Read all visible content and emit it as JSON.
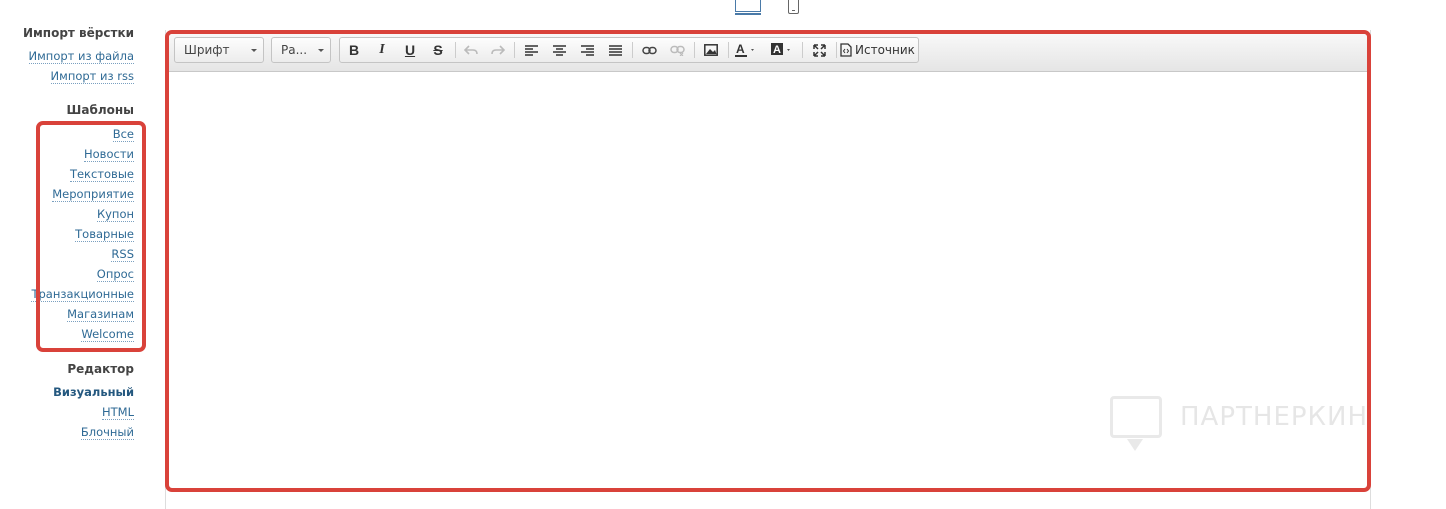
{
  "sidebar": {
    "import": {
      "title": "Импорт вёрстки",
      "items": [
        "Импорт из файла",
        "Импорт из rss"
      ]
    },
    "templates": {
      "title": "Шаблоны",
      "items": [
        "Все",
        "Новости",
        "Текстовые",
        "Мероприятие",
        "Купон",
        "Товарные",
        "RSS",
        "Опрос",
        "Транзакционные",
        "Магазинам",
        "Welcome"
      ]
    },
    "editor": {
      "title": "Редактор",
      "items": [
        "Визуальный",
        "HTML",
        "Блочный"
      ],
      "active": "Визуальный"
    }
  },
  "toolbar": {
    "font_label": "Шрифт",
    "size_label": "Ра...",
    "source_label": "Источник",
    "icons": [
      "bold-icon",
      "italic-icon",
      "underline-icon",
      "strikethrough-icon",
      "undo-icon",
      "redo-icon",
      "align-left-icon",
      "align-center-icon",
      "align-right-icon",
      "align-justify-icon",
      "link-icon",
      "unlink-icon",
      "image-icon",
      "text-color-icon",
      "background-color-icon",
      "maximize-icon",
      "source-icon"
    ]
  },
  "watermark": {
    "text": "ПАРТНЕРКИН"
  },
  "colors": {
    "highlight": "#d9423a",
    "link": "#2f6a95"
  }
}
